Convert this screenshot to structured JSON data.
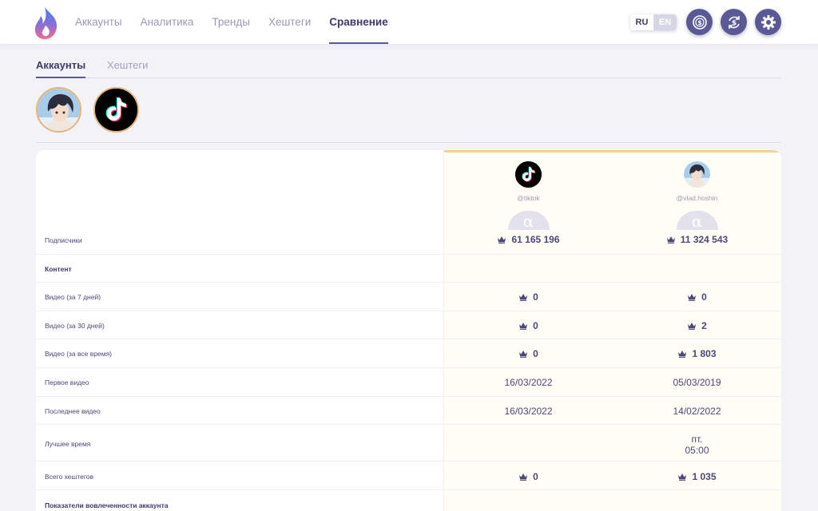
{
  "nav": {
    "items": [
      {
        "label": "Аккаунты",
        "active": false
      },
      {
        "label": "Аналитика",
        "active": false
      },
      {
        "label": "Тренды",
        "active": false
      },
      {
        "label": "Хештеги",
        "active": false
      },
      {
        "label": "Сравнение",
        "active": true
      }
    ]
  },
  "lang": {
    "ru": "RU",
    "en": "EN",
    "selected": "RU"
  },
  "header_icons": [
    "coin-icon",
    "currency-exchange-icon",
    "gear-icon"
  ],
  "subtabs": [
    {
      "label": "Аккаунты",
      "active": true
    },
    {
      "label": "Хештеги",
      "active": false
    }
  ],
  "selected_avatars": [
    "anime-avatar",
    "tiktok-logo"
  ],
  "columns": [
    {
      "handle": "@tiktok",
      "badge": "α"
    },
    {
      "handle": "@vlad.hoshin",
      "badge": "α"
    }
  ],
  "rows": [
    {
      "label": "Подписчики",
      "type": "data",
      "v1": "61 165 196",
      "v2": "11 324 543",
      "crown1": true,
      "crown2": true
    },
    {
      "label": "Контент",
      "type": "section"
    },
    {
      "label": "Видео (за 7 дней)",
      "type": "data",
      "v1": "0",
      "v2": "0",
      "crown1": true,
      "crown2": true
    },
    {
      "label": "Видео (за 30 дней)",
      "type": "data",
      "v1": "0",
      "v2": "2",
      "crown1": true,
      "crown2": true
    },
    {
      "label": "Видео (за все время)",
      "type": "data",
      "v1": "0",
      "v2": "1 803",
      "crown1": true,
      "crown2": true
    },
    {
      "label": "Первое видео",
      "type": "data",
      "v1": "16/03/2022",
      "v2": "05/03/2019",
      "crown1": false,
      "crown2": false
    },
    {
      "label": "Последнее видео",
      "type": "data",
      "v1": "16/03/2022",
      "v2": "14/02/2022",
      "crown1": false,
      "crown2": false
    },
    {
      "label": "Лучшее время",
      "type": "data",
      "v1": "",
      "v2_line1": "пт.",
      "v2_line2": "05:00",
      "crown1": false,
      "crown2": false
    },
    {
      "label": "Всего хештегов",
      "type": "data",
      "v1": "0",
      "v2": "1 035",
      "crown1": true,
      "crown2": true
    },
    {
      "label": "Показатели вовлеченности аккаунта",
      "type": "section"
    }
  ],
  "colors": {
    "accent": "#5b5896",
    "gold": "#f3d28d",
    "text": "#3d3a6b"
  }
}
